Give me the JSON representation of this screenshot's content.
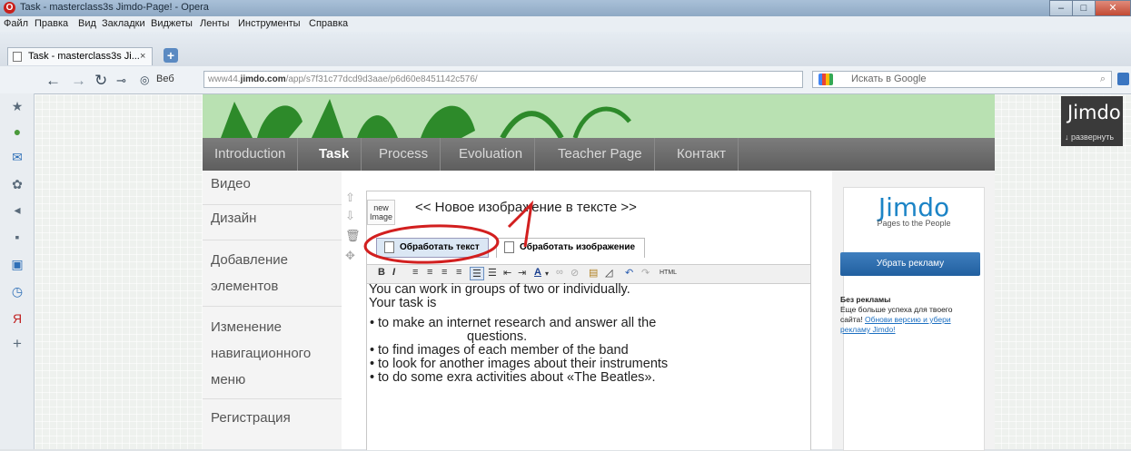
{
  "window": {
    "title": "Task - masterclass3s Jimdo-Page! - Opera",
    "min": "–",
    "max": "□",
    "close": "✕"
  },
  "menu": [
    "Файл",
    "Правка",
    "Вид",
    "Закладки",
    "Виджеты",
    "Ленты",
    "Инструменты",
    "Справка"
  ],
  "tab": {
    "title": "Task - masterclass3s Ji...",
    "close": "×",
    "new": "+"
  },
  "address": {
    "web_label": "Веб",
    "url_host": "www44.",
    "url_domain": "jimdo.com",
    "url_path": "/app/s7f31c77dcd9d3aae/p6d60e8451142c576/"
  },
  "search": {
    "placeholder": "Искать в Google"
  },
  "site_nav": [
    "Introduction",
    "Task",
    "Process",
    "Evoluation",
    "Teacher Page",
    "Контакт"
  ],
  "site_nav_active": "Task",
  "left_menu": {
    "video": "Видео",
    "design": "Дизайн",
    "add1": "Добавление",
    "add2": "элементов",
    "nav1": "Изменение",
    "nav2": "навигационного",
    "nav3": "меню",
    "reg": "Регистрация"
  },
  "editor": {
    "new_image1": "new",
    "new_image2": "Image",
    "heading": "<< Новое изображение в тексте >>",
    "tab_text": "Обработать текст",
    "tab_image": "Обработать изображение",
    "html_btn": "HTML",
    "line1": "You can  work in groups of two or individually.",
    "line2": "Your task is",
    "items": [
      "to make an internet research and answer all the",
      "questions.",
      "to find images of each member of the band",
      "to look for another images about their instruments",
      "to do some exra activities about «The Beatles»."
    ]
  },
  "ad": {
    "logo": "Jimdo",
    "tagline": "Pages to the People",
    "button": "Убрать рекламу",
    "title": "Без рекламы",
    "text1": "Еще больше успеха для твоего сайта!",
    "link": "Обнови версию и убери рекламу Jimdo!"
  },
  "badge": {
    "logo": "Jimdo",
    "expand": "↓ развернуть"
  },
  "annotation_color": "#d21f1f"
}
